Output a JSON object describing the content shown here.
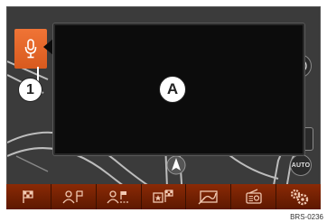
{
  "callouts": {
    "one": "1",
    "a": "A"
  },
  "side_buttons": {
    "auto_label": "AUTO"
  },
  "toolbar": {
    "items": [
      "destination-flag-icon",
      "contacts-destination-icon",
      "route-contacts-icon",
      "favorite-destination-icon",
      "map-route-icon",
      "radio-icon",
      "settings-gears-icon"
    ]
  },
  "reference_code": "BRS-0236",
  "colors": {
    "accent": "#e8672c",
    "toolbar": "#7a2405",
    "dialog": "#0c0c0c"
  }
}
